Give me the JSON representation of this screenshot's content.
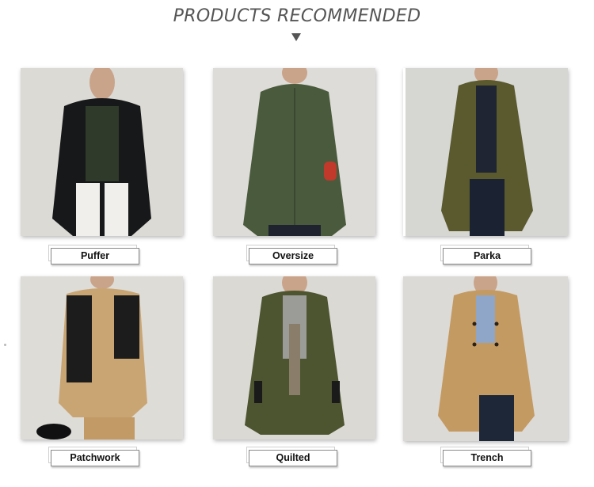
{
  "header": {
    "title": "PRODUCTS RECOMMENDED",
    "arrow_icon": "triangle-down-icon"
  },
  "products": [
    {
      "label": "Puffer",
      "coat_color": "#17181a",
      "backdrop": "#dcdad5"
    },
    {
      "label": "Oversize",
      "coat_color": "#4a5a3c",
      "backdrop": "#dddcd8"
    },
    {
      "label": "Parka",
      "coat_color": "#5a5a2e",
      "backdrop": "#d6d6d3"
    },
    {
      "label": "Patchwork",
      "coat_color": "#c9a574",
      "backdrop": "#dedcd7"
    },
    {
      "label": "Quilted",
      "coat_color": "#4d5430",
      "backdrop": "#dad9d4"
    },
    {
      "label": "Trench",
      "coat_color": "#c49a63",
      "backdrop": "#dcdad6"
    }
  ]
}
